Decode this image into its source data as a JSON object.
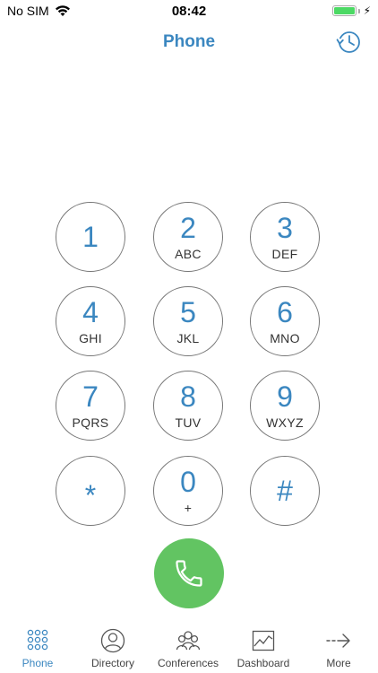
{
  "status_bar": {
    "carrier": "No SIM",
    "time": "08:42"
  },
  "header": {
    "title": "Phone"
  },
  "keypad": {
    "keys": [
      {
        "digit": "1",
        "letters": ""
      },
      {
        "digit": "2",
        "letters": "ABC"
      },
      {
        "digit": "3",
        "letters": "DEF"
      },
      {
        "digit": "4",
        "letters": "GHI"
      },
      {
        "digit": "5",
        "letters": "JKL"
      },
      {
        "digit": "6",
        "letters": "MNO"
      },
      {
        "digit": "7",
        "letters": "PQRS"
      },
      {
        "digit": "8",
        "letters": "TUV"
      },
      {
        "digit": "9",
        "letters": "WXYZ"
      },
      {
        "digit": "*",
        "letters": ""
      },
      {
        "digit": "0",
        "letters": "+"
      },
      {
        "digit": "#",
        "letters": ""
      }
    ]
  },
  "tabs": [
    {
      "label": "Phone",
      "icon": "keypad-grid-icon",
      "active": true
    },
    {
      "label": "Directory",
      "icon": "person-icon",
      "active": false
    },
    {
      "label": "Conferences",
      "icon": "group-icon",
      "active": false
    },
    {
      "label": "Dashboard",
      "icon": "chart-icon",
      "active": false
    },
    {
      "label": "More",
      "icon": "arrow-right-icon",
      "active": false
    }
  ],
  "colors": {
    "accent": "#3b87c0",
    "call": "#62c462",
    "battery": "#4cd964"
  }
}
